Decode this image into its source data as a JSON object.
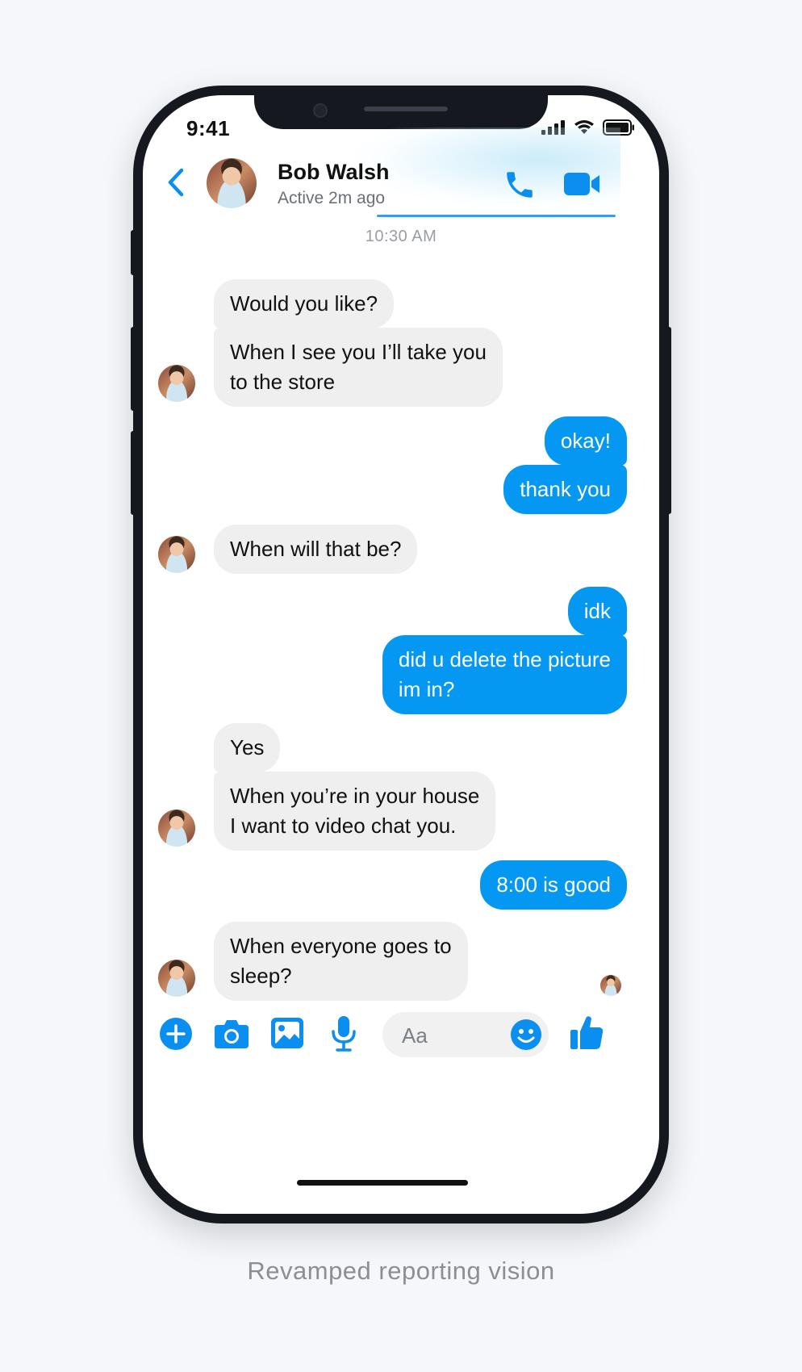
{
  "status_bar": {
    "time": "9:41"
  },
  "header": {
    "name": "Bob Walsh",
    "status": "Active 2m ago"
  },
  "conversation": {
    "timestamp": "10:30 AM",
    "messages": [
      {
        "from": "them",
        "text": "Would you like?"
      },
      {
        "from": "them",
        "line1": "When I see you I’ll take you",
        "line2": "to the store"
      },
      {
        "from": "me",
        "text": "okay!"
      },
      {
        "from": "me",
        "text": "thank you"
      },
      {
        "from": "them",
        "text": "When will that be?"
      },
      {
        "from": "me",
        "text": "idk"
      },
      {
        "from": "me",
        "line1": "did u delete the picture",
        "line2": "im in?"
      },
      {
        "from": "them",
        "text": "Yes"
      },
      {
        "from": "them",
        "line1": "When you’re in your house",
        "line2": "I want to video chat you."
      },
      {
        "from": "me",
        "text": "8:00 is good"
      },
      {
        "from": "them",
        "line1": "When everyone goes to",
        "line2": "sleep?"
      }
    ]
  },
  "composer": {
    "placeholder": "Aa",
    "icons": [
      "plus-icon",
      "camera-icon",
      "image-icon",
      "microphone-icon",
      "emoji-icon",
      "thumbs-up-icon"
    ]
  },
  "colors": {
    "accent": "#0498f2",
    "incoming_bubble": "#efefef",
    "frame": "#15181f",
    "background": "#f5f7fa"
  },
  "caption": "Revamped reporting vision"
}
